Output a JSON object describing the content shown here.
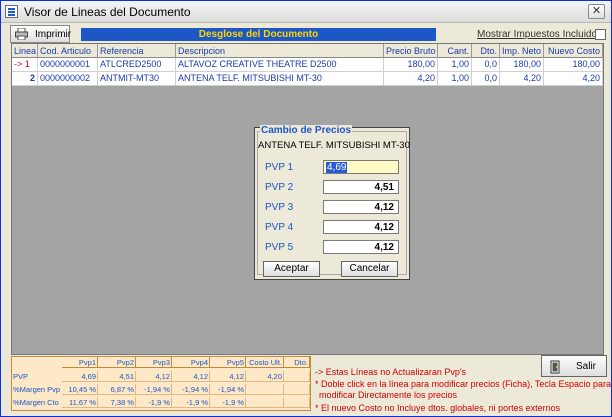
{
  "window": {
    "title": "Visor de Lineas del Documento",
    "close_label": "✕"
  },
  "toolbar": {
    "print_label": "Imprimir",
    "banner": "Desglose del Documento",
    "show_taxes_label": "Mostrar Impuestos Incluidos"
  },
  "grid": {
    "headers": [
      "Linea",
      "Cod. Articulo",
      "Referencia",
      "Descripcion",
      "Precio Bruto",
      "Cant.",
      "Dto.",
      "Imp. Neto",
      "Nuevo Costo"
    ],
    "rows": [
      {
        "indicator": "->",
        "line": "1",
        "code": "0000000001",
        "ref": "ATLCRED2500",
        "desc": "ALTAVOZ CREATIVE THEATRE D2500",
        "price": "180,00",
        "qty": "1,00",
        "dto": "0,0",
        "net": "180,00",
        "cost": "180,00"
      },
      {
        "indicator": "",
        "line": "2",
        "code": "0000000002",
        "ref": "ANTMIT-MT30",
        "desc": "ANTENA TELF. MITSUBISHI MT-30",
        "price": "4,20",
        "qty": "1,00",
        "dto": "0,0",
        "net": "4,20",
        "cost": "4,20"
      }
    ]
  },
  "dialog": {
    "title": "Cambio de Precios",
    "product": "ANTENA TELF. MITSUBISHI MT-30",
    "prices": [
      {
        "label": "PVP 1",
        "value": "4,69"
      },
      {
        "label": "PVP 2",
        "value": "4,51"
      },
      {
        "label": "PVP 3",
        "value": "4,12"
      },
      {
        "label": "PVP 4",
        "value": "4,12"
      },
      {
        "label": "PVP 5",
        "value": "4,12"
      }
    ],
    "accept_label": "Aceptar",
    "cancel_label": "Cancelar"
  },
  "summary": {
    "headers": [
      "Pvp1",
      "Pvp2",
      "Pvp3",
      "Pvp4",
      "Pvp5",
      "Costo Ult.",
      "Dto."
    ],
    "rows": [
      {
        "label": "PVP",
        "values": [
          "4,69",
          "4,51",
          "4,12",
          "4,12",
          "4,12",
          "4,20",
          ""
        ]
      },
      {
        "label": "%Margen Pvp",
        "values": [
          "10,45 %",
          "6,87 %",
          "-1,94 %",
          "-1,94 %",
          "-1,94 %",
          "",
          ""
        ]
      },
      {
        "label": "%Margen Cto",
        "values": [
          "11,67 %",
          "7,38 %",
          "-1,9 %",
          "-1,9 %",
          "-1,9 %",
          "",
          ""
        ]
      }
    ]
  },
  "notes": {
    "line1": "-> Estas Líneas no Actualizaran Pvp's",
    "line2a": "* Doble click en la línea para modificar precios (Ficha), Tecla Espacio para",
    "line2b": "modificar Directamente los precios",
    "line3": "* El nuevo Costo no Incluye dtos. globales, ni portes externos"
  },
  "exit_label": "Salir",
  "colors": {
    "banner_bg": "#1d57c6",
    "banner_text": "#ffd500",
    "note_text": "#d10000",
    "grid_text": "#1a3ba8"
  }
}
